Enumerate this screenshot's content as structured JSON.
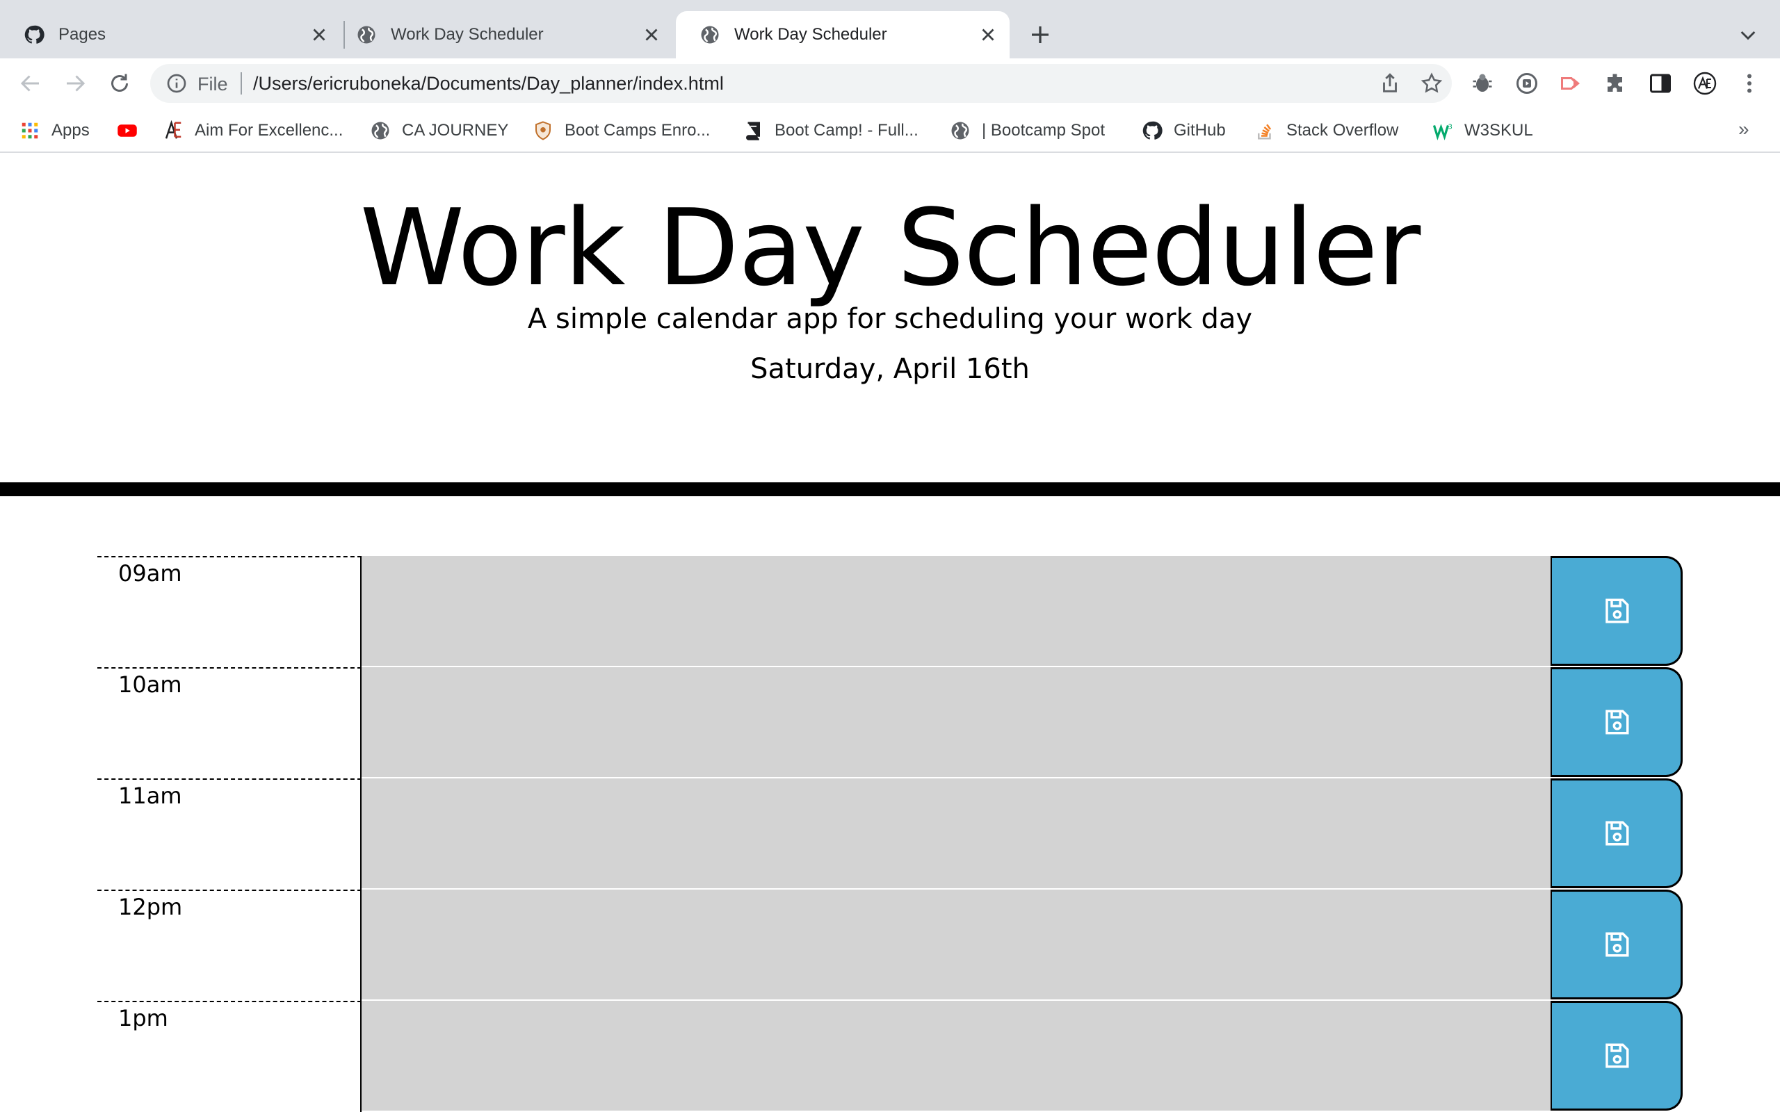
{
  "browser": {
    "tabs": [
      {
        "title": "Pages",
        "icon": "github-icon",
        "active": false
      },
      {
        "title": "Work Day Scheduler",
        "icon": "globe-icon",
        "active": false
      },
      {
        "title": "Work Day Scheduler",
        "icon": "globe-icon",
        "active": true
      }
    ],
    "omnibox": {
      "scheme_label": "File",
      "url": "/Users/ericruboneka/Documents/Day_planner/index.html"
    },
    "bookmarks": [
      {
        "label": "Apps",
        "icon": "apps-grid-icon"
      },
      {
        "label": "",
        "icon": "youtube-icon"
      },
      {
        "label": "Aim For Excellenc...",
        "icon": "ae-logo-icon"
      },
      {
        "label": "CA JOURNEY",
        "icon": "globe-icon"
      },
      {
        "label": "Boot Camps Enro...",
        "icon": "shield-crest-icon"
      },
      {
        "label": "Boot Camp! - Full...",
        "icon": "book-icon"
      },
      {
        "label": "| Bootcamp Spot",
        "icon": "globe-icon"
      },
      {
        "label": "GitHub",
        "icon": "github-icon"
      },
      {
        "label": "Stack Overflow",
        "icon": "stackoverflow-icon"
      },
      {
        "label": "W3SKUL",
        "icon": "w3-icon"
      }
    ],
    "bookmarks_overflow": "»"
  },
  "header": {
    "title": "Work Day Scheduler",
    "lead": "A simple calendar app for scheduling your work day",
    "current_day": "Saturday, April 16th"
  },
  "time_blocks": [
    {
      "hour": "09am",
      "text": "",
      "state": "past"
    },
    {
      "hour": "10am",
      "text": "",
      "state": "past"
    },
    {
      "hour": "11am",
      "text": "",
      "state": "past"
    },
    {
      "hour": "12pm",
      "text": "",
      "state": "past"
    },
    {
      "hour": "1pm",
      "text": "",
      "state": "past"
    }
  ],
  "colors": {
    "past": "#d3d3d3",
    "save_button": "#4aabd4",
    "tabstrip": "#dee1e6"
  }
}
